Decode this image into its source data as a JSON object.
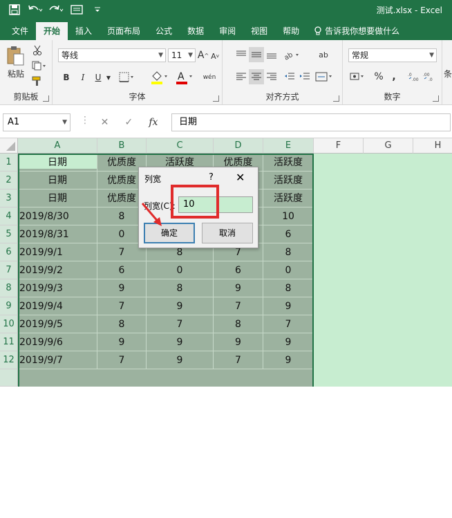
{
  "window": {
    "title": "测试.xlsx  -  Excel",
    "accent": "#217346"
  },
  "qat": {
    "icons": [
      "save-icon",
      "undo-icon",
      "redo-icon",
      "form-icon",
      "customize-icon"
    ]
  },
  "tabs": [
    {
      "label": "文件"
    },
    {
      "label": "开始"
    },
    {
      "label": "插入"
    },
    {
      "label": "页面布局"
    },
    {
      "label": "公式"
    },
    {
      "label": "数据"
    },
    {
      "label": "审阅"
    },
    {
      "label": "视图"
    },
    {
      "label": "帮助"
    }
  ],
  "tell_me": "告诉我你想要做什么",
  "ribbon": {
    "clipboard": {
      "paste_label": "粘贴",
      "group_label": "剪贴板"
    },
    "font": {
      "font_name": "等线",
      "font_size": "11",
      "group_label": "字体",
      "bold": "B",
      "italic": "I",
      "underline": "U",
      "grow": "A",
      "shrink": "A",
      "color_a": "A",
      "phonetic": "wén"
    },
    "alignment": {
      "group_label": "对齐方式",
      "wrap": "ab"
    },
    "number": {
      "format": "常规",
      "group_label": "数字",
      "percent": "%",
      "comma": ","
    },
    "styles_partial": "条"
  },
  "formula_bar": {
    "name_box": "A1",
    "formula": "日期",
    "fx": "fx",
    "cancel": "✕",
    "enter": "✓"
  },
  "columns": [
    "A",
    "B",
    "C",
    "D",
    "E",
    "F",
    "G",
    "H"
  ],
  "rows": [
    "1",
    "2",
    "3",
    "4",
    "5",
    "6",
    "7",
    "8",
    "9",
    "10",
    "11",
    "12"
  ],
  "cells": [
    [
      "日期",
      "优质度",
      "活跃度",
      "优质度",
      "活跃度"
    ],
    [
      "日期",
      "优质度",
      "活跃度",
      "优质度",
      "活跃度"
    ],
    [
      "日期",
      "优质度",
      "活跃度",
      "优质度",
      "活跃度"
    ],
    [
      "2019/8/30",
      "8",
      "",
      "",
      "10"
    ],
    [
      "2019/8/31",
      "0",
      "",
      "",
      "6"
    ],
    [
      "2019/9/1",
      "7",
      "8",
      "7",
      "8"
    ],
    [
      "2019/9/2",
      "6",
      "0",
      "6",
      "0"
    ],
    [
      "2019/9/3",
      "9",
      "8",
      "9",
      "8"
    ],
    [
      "2019/9/4",
      "7",
      "9",
      "7",
      "9"
    ],
    [
      "2019/9/5",
      "8",
      "7",
      "8",
      "7"
    ],
    [
      "2019/9/6",
      "9",
      "9",
      "9",
      "9"
    ],
    [
      "2019/9/7",
      "7",
      "9",
      "7",
      "9"
    ]
  ],
  "dialog": {
    "title": "列宽",
    "help": "?",
    "close": "✕",
    "label": "列宽(C):",
    "value": "10",
    "ok": "确定",
    "cancel": "取消"
  },
  "watermark": {
    "brand": "Bai 经验",
    "url": "jingyan.baidu.com"
  }
}
